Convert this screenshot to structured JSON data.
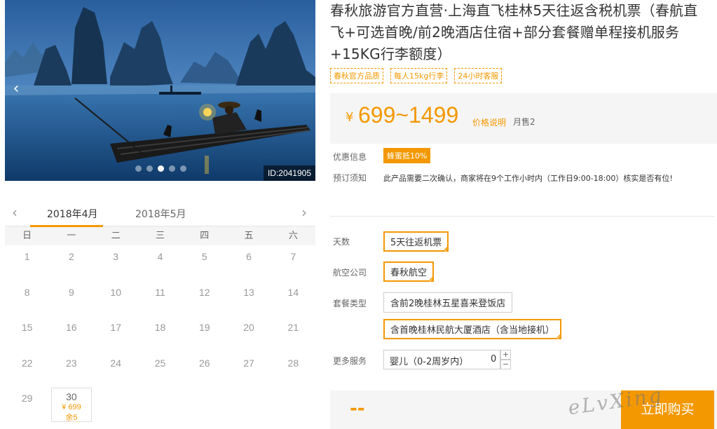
{
  "gallery": {
    "prev_icon": "chevron-left-icon",
    "next_icon": "chevron-right-icon",
    "prev_glyph": "‹",
    "next_glyph": "›",
    "dots": [
      false,
      false,
      true,
      false,
      false
    ],
    "image_id": "ID:2041905"
  },
  "calendar": {
    "prev_glyph": "‹",
    "next_glyph": "›",
    "tabs": [
      "2018年4月",
      "2018年5月"
    ],
    "active_tab": 0,
    "weekdays": [
      "日",
      "一",
      "二",
      "三",
      "四",
      "五",
      "六"
    ],
    "days": [
      {
        "d": "1"
      },
      {
        "d": "2"
      },
      {
        "d": "3"
      },
      {
        "d": "4"
      },
      {
        "d": "5"
      },
      {
        "d": "6"
      },
      {
        "d": "7"
      },
      {
        "d": "8"
      },
      {
        "d": "9"
      },
      {
        "d": "10"
      },
      {
        "d": "11"
      },
      {
        "d": "12"
      },
      {
        "d": "13"
      },
      {
        "d": "14"
      },
      {
        "d": "15"
      },
      {
        "d": "16"
      },
      {
        "d": "17"
      },
      {
        "d": "18"
      },
      {
        "d": "19"
      },
      {
        "d": "20"
      },
      {
        "d": "21"
      },
      {
        "d": "22"
      },
      {
        "d": "23"
      },
      {
        "d": "24"
      },
      {
        "d": "25"
      },
      {
        "d": "26"
      },
      {
        "d": "27"
      },
      {
        "d": "28"
      },
      {
        "d": "29"
      },
      {
        "d": "30",
        "price": "¥ 699",
        "left": "余5"
      }
    ]
  },
  "product": {
    "title": "春秋旅游官方直营·上海直飞桂林5天往返含税机票（春航直飞+可选首晚/前2晚酒店住宿+部分套餐赠单程接机服务+15KG行李额度）",
    "tags": [
      "春秋官方品质",
      "每人15kg行李",
      "24小时客服"
    ],
    "price_currency": "¥",
    "price_range": "699~1499",
    "price_note": "价格说明",
    "monthly_sales": "月售2",
    "promo_label": "优惠信息",
    "promo_badge": "蜂蜜抵10%",
    "notice_label": "预订须知",
    "notice_text": "此产品需要二次确认，商家将在9个工作小时内（工作日9:00-18:00）核实是否有位!",
    "days_label": "天数",
    "days_option": "5天往返机票",
    "airline_label": "航空公司",
    "airline_option": "春秋航空",
    "package_label": "套餐类型",
    "package_options": [
      "含前2晚桂林五星喜来登饭店",
      "含首晚桂林民航大厦酒店（含当地接机）"
    ],
    "package_selected": 1,
    "services_label": "更多服务",
    "infant_label": "婴儿（0-2周岁内）",
    "infant_count": "0",
    "plus": "+",
    "minus": "−",
    "total_placeholder": "--",
    "buy_button": "立即购买"
  },
  "watermark": "eLvXing",
  "colors": {
    "accent": "#f39800",
    "price_bg": "#f5f5f5"
  }
}
